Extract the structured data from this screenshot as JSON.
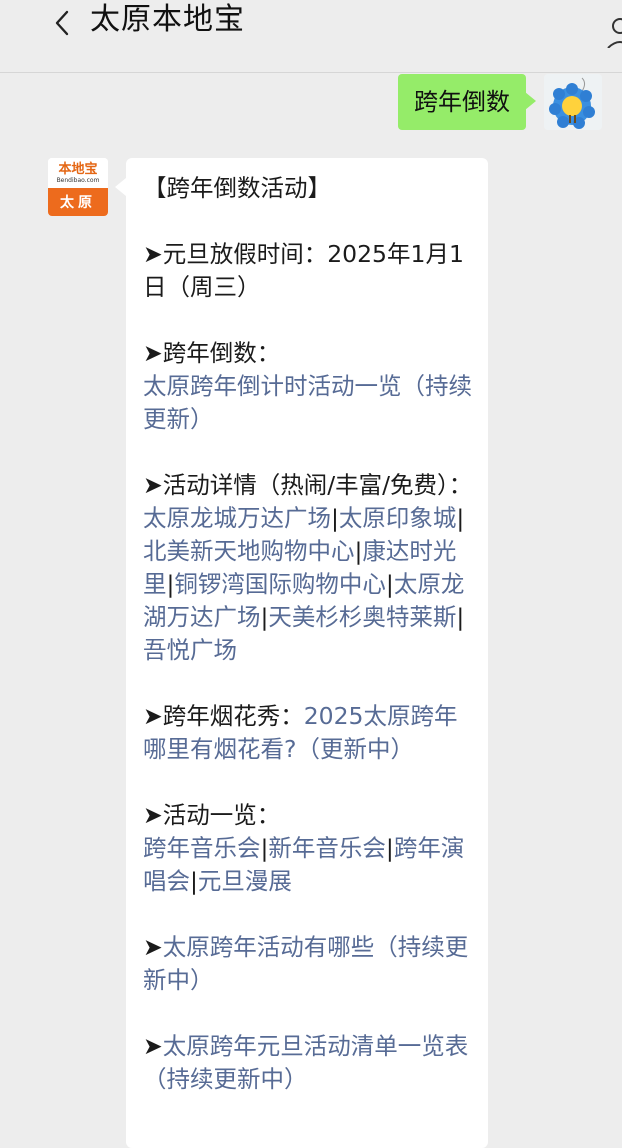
{
  "header": {
    "back_icon": "chevron-left-icon",
    "title": "太原本地宝",
    "user_icon": "person-icon"
  },
  "chat": {
    "sent_message": "跨年倒数",
    "sender_avatar": "flower-avatar",
    "bot_avatar": {
      "logo_text": "本地宝",
      "logo_sub": "Bendibao.com",
      "city": "太原"
    },
    "reply": {
      "heading": "【跨年倒数活动】",
      "holiday_label": "➤元旦放假时间：2025年1月1日（周三）",
      "countdown_label": "➤跨年倒数：",
      "countdown_link": "太原跨年倒计时活动一览（持续更新）",
      "events_label": "➤活动详情（热闹/丰富/免费）：",
      "venues": [
        "太原龙城万达广场",
        "太原印象城",
        "北美新天地购物中心",
        "康达时光里",
        "铜锣湾国际购物中心",
        "太原龙湖万达广场",
        "天美杉杉奥特莱斯",
        "吾悦广场"
      ],
      "fireworks_label": "➤跨年烟花秀：",
      "fireworks_link": "2025太原跨年哪里有烟花看?（更新中）",
      "overview_label": "➤活动一览：",
      "overview_links": [
        "跨年音乐会",
        "新年音乐会",
        "跨年演唱会",
        "元旦漫展"
      ],
      "arrow": "➤",
      "link_activities": "太原跨年活动有哪些（持续更新中）",
      "link_list": "太原跨年元旦活动清单一览表（持续更新中）"
    }
  },
  "colors": {
    "background": "#ededed",
    "sent_bubble": "#95ec69",
    "link": "#576b95",
    "logo_orange": "#ed6b1d"
  }
}
